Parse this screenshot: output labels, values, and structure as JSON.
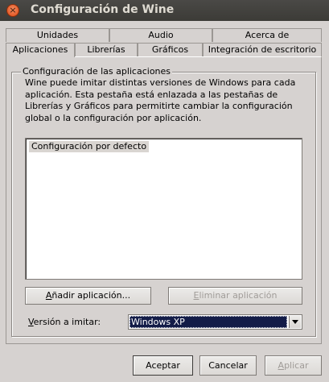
{
  "window": {
    "title": "Configuración de Wine",
    "close_glyph": "×"
  },
  "tabs": {
    "row1": [
      {
        "label": "Unidades"
      },
      {
        "label": "Audio"
      },
      {
        "label": "Acerca de"
      }
    ],
    "row2": [
      {
        "label": "Aplicaciones",
        "active": true
      },
      {
        "label": "Librerías"
      },
      {
        "label": "Gráficos"
      },
      {
        "label": "Integración de escritorio"
      }
    ]
  },
  "apps": {
    "group_label": "Configuración de las aplicaciones",
    "description": "Wine puede imitar distintas versiones de Windows para cada aplicación. Esta pestaña está enlazada a las pestañas de Librerías y Gráficos para permitirte cambiar la configuración global o la configuración por aplicación.",
    "list_items": [
      "Configuración por defecto"
    ],
    "add_button": {
      "mnemonic": "A",
      "rest": "ñadir aplicación..."
    },
    "remove_button": {
      "mnemonic": "E",
      "rest": "liminar aplicación"
    },
    "version_label": {
      "mnemonic": "V",
      "rest": "ersión a imitar:"
    },
    "version_value": "Windows XP"
  },
  "buttons": {
    "accept": "Aceptar",
    "cancel": "Cancelar",
    "apply": {
      "mnemonic": "A",
      "rest": "plicar"
    }
  },
  "colors": {
    "titlebar": "#3c3b37",
    "title_text": "#dfdbd2",
    "close_button": "#df4a16",
    "window_bg": "#d6d2d0",
    "selection": "#131c48"
  }
}
